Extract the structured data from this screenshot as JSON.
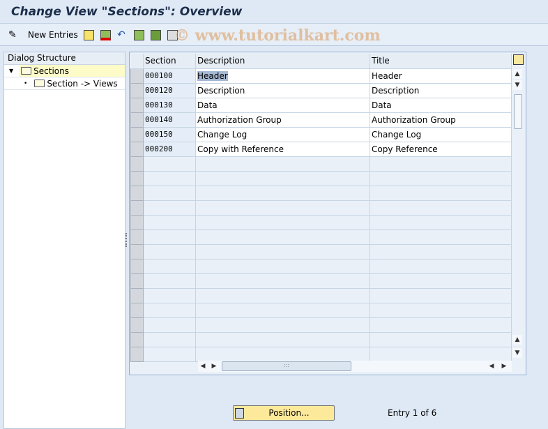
{
  "title": "Change View \"Sections\": Overview",
  "toolbar": {
    "new_entries": "New Entries",
    "watermark": "© www.tutorialkart.com"
  },
  "dialog": {
    "header": "Dialog Structure",
    "items": [
      {
        "label": "Sections",
        "selected": true
      },
      {
        "label": "Section -> Views"
      }
    ]
  },
  "table": {
    "columns": [
      "Section",
      "Description",
      "Title"
    ],
    "rows": [
      {
        "section": "000100",
        "description": "Header",
        "title": "Header"
      },
      {
        "section": "000120",
        "description": "Description",
        "title": "Description"
      },
      {
        "section": "000130",
        "description": "Data",
        "title": "Data"
      },
      {
        "section": "000140",
        "description": "Authorization Group",
        "title": "Authorization Group"
      },
      {
        "section": "000150",
        "description": "Change Log",
        "title": "Change Log"
      },
      {
        "section": "000200",
        "description": "Copy with Reference",
        "title": "Copy Reference"
      }
    ]
  },
  "footer": {
    "position_label": "Position...",
    "entry": "Entry 1 of 6"
  }
}
